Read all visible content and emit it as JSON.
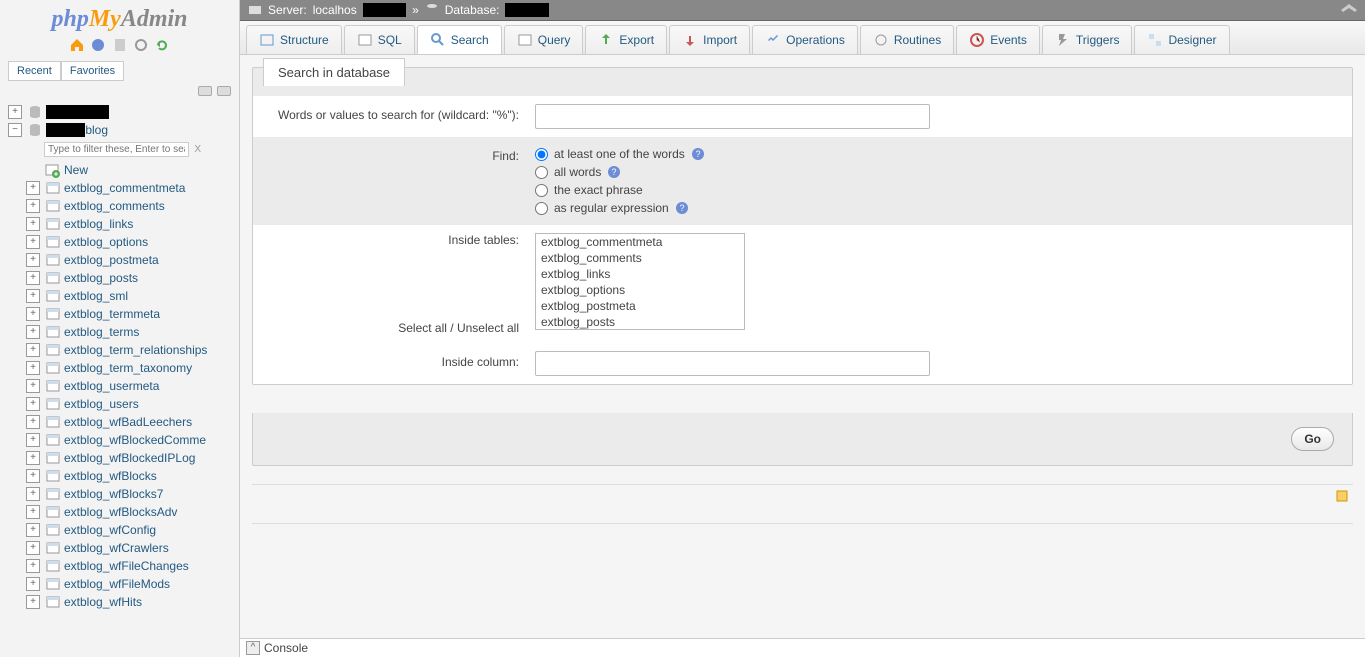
{
  "logo": {
    "php": "php",
    "my": "My",
    "admin": "Admin"
  },
  "sidebar": {
    "recent_label": "Recent",
    "favorites_label": "Favorites",
    "filter_placeholder": "Type to filter these, Enter to searc",
    "new_label": "New",
    "db_suffix": "blog",
    "tables": [
      "extblog_commentmeta",
      "extblog_comments",
      "extblog_links",
      "extblog_options",
      "extblog_postmeta",
      "extblog_posts",
      "extblog_sml",
      "extblog_termmeta",
      "extblog_terms",
      "extblog_term_relationships",
      "extblog_term_taxonomy",
      "extblog_usermeta",
      "extblog_users",
      "extblog_wfBadLeechers",
      "extblog_wfBlockedComme",
      "extblog_wfBlockedIPLog",
      "extblog_wfBlocks",
      "extblog_wfBlocks7",
      "extblog_wfBlocksAdv",
      "extblog_wfConfig",
      "extblog_wfCrawlers",
      "extblog_wfFileChanges",
      "extblog_wfFileMods",
      "extblog_wfHits"
    ]
  },
  "breadcrumb": {
    "server_label": "Server:",
    "server_value": "localhos",
    "database_label": "Database:"
  },
  "tabs": [
    "Structure",
    "SQL",
    "Search",
    "Query",
    "Export",
    "Import",
    "Operations",
    "Routines",
    "Events",
    "Triggers",
    "Designer"
  ],
  "form": {
    "legend": "Search in database",
    "search_words_label": "Words or values to search for (wildcard: \"%\"):",
    "find_label": "Find:",
    "radio_at_least": "at least one of the words",
    "radio_all_words": "all words",
    "radio_exact": "the exact phrase",
    "radio_regex": "as regular expression",
    "inside_tables_label": "Inside tables:",
    "select_all": "Select all",
    "unselect_all": "Unselect all",
    "select_separator": "  / ",
    "inside_column_label": "Inside column:",
    "table_options": [
      "extblog_commentmeta",
      "extblog_comments",
      "extblog_links",
      "extblog_options",
      "extblog_postmeta",
      "extblog_posts"
    ],
    "go_label": "Go"
  },
  "console": {
    "label": "Console"
  }
}
